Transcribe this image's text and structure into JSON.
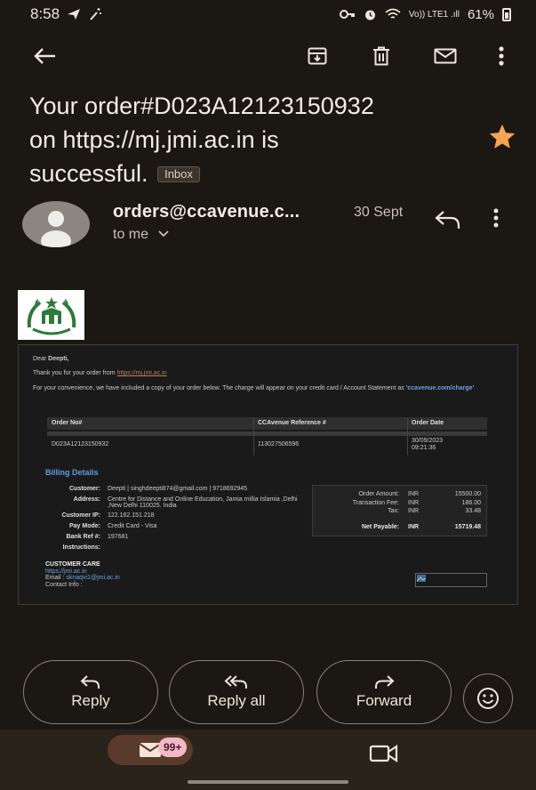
{
  "status_bar": {
    "time": "8:58",
    "signal_text": "Vo)) LTE1 .ıll",
    "battery": "61%"
  },
  "subject": {
    "line1": "Your order#D023A12123150932",
    "line2": "on https://mj.jmi.ac.in is",
    "line3": "successful.",
    "label": "Inbox"
  },
  "message": {
    "sender": "orders@ccavenue.c...",
    "date": "30 Sept",
    "recipient": "to me"
  },
  "email": {
    "greeting": "Dear",
    "name": "Deepti,",
    "thanks": "Thank you for your order from",
    "thanks_link": "https://mj.jmi.ac.in",
    "convenience": "For your convenience, we have included a copy of your order below. The charge will appear on your credit card / Account Statement as",
    "charge_name": "'ccavenue.com/charge'",
    "order_table": {
      "headers": [
        "Order No#",
        "CCAvenue Reference #",
        "Order Date"
      ],
      "row": [
        "D023A12123150932",
        "113027506596",
        "30/09/2023",
        "09:21:36"
      ]
    },
    "billing_title": "Billing Details",
    "billing": [
      {
        "label": "Customer:",
        "value": "Deepti | singhdeepti874@gmail.com | 9718692945"
      },
      {
        "label": "Address:",
        "value": "Centre for Distance and Online Education, Jamia millia Islamia ,Delhi ,New Delhi 110025. India"
      },
      {
        "label": "Customer IP:",
        "value": "122.162.151.218"
      },
      {
        "label": "Pay Mode:",
        "value": "Credit Card - Visa"
      },
      {
        "label": "Bank Ref #:",
        "value": "197681"
      },
      {
        "label": "Instructions:",
        "value": ""
      }
    ],
    "amounts": [
      {
        "label": "Order Amount:",
        "currency": "INR",
        "value": "15500.00"
      },
      {
        "label": "Transaction Fee:",
        "currency": "INR",
        "value": "186.00"
      },
      {
        "label": "Tax:",
        "currency": "INR",
        "value": "33.48"
      },
      {
        "label": "Net Payable:",
        "currency": "INR",
        "value": "15719.48"
      }
    ],
    "care": {
      "title": "CUSTOMER CARE",
      "url": "https://jmi.ac.in",
      "email_label": "Email :",
      "email": "sknaqvi1@jmi.ac.in",
      "contact_label": "Contact Info :"
    }
  },
  "actions": {
    "reply": "Reply",
    "reply_all": "Reply all",
    "forward": "Forward"
  },
  "nav": {
    "badge": "99+"
  },
  "colors": {
    "background": "#1b1712",
    "star": "#f5a356",
    "link_blue": "#6da0e0",
    "nav_bg": "#29231c",
    "badge": "#f2b8c6"
  }
}
